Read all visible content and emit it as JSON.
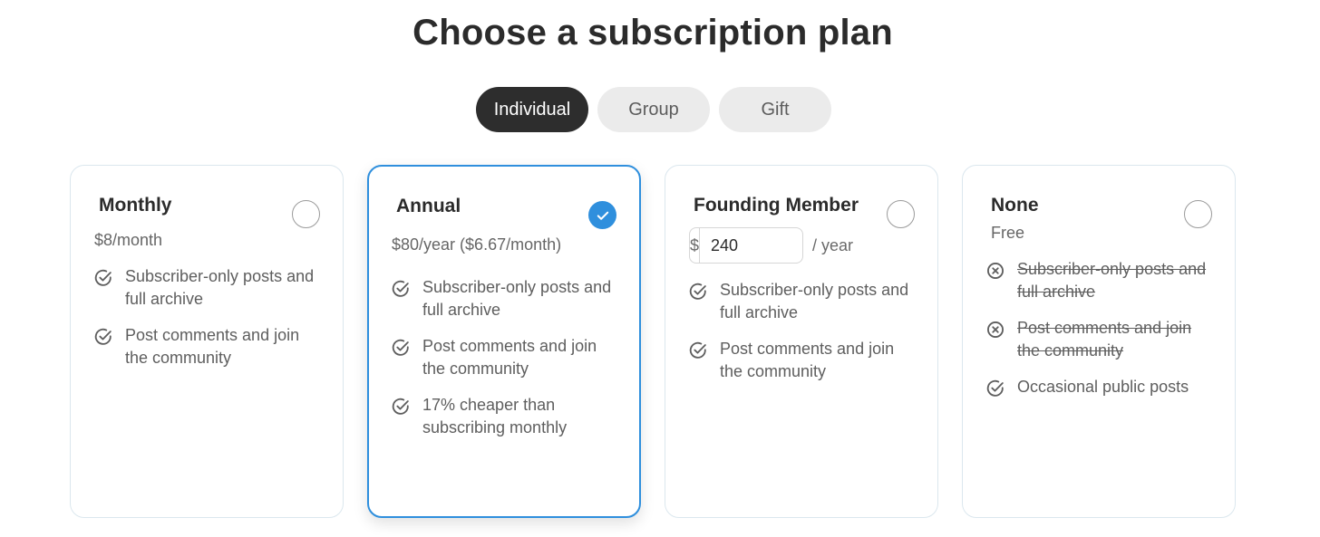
{
  "page": {
    "title": "Choose a subscription plan"
  },
  "tabs": [
    {
      "label": "Individual",
      "active": true
    },
    {
      "label": "Group",
      "active": false
    },
    {
      "label": "Gift",
      "active": false
    }
  ],
  "plans": [
    {
      "name": "Monthly",
      "price": "$8/month",
      "selected": false,
      "features": [
        {
          "text": "Subscriber-only posts and full archive",
          "included": true
        },
        {
          "text": "Post comments and join the community",
          "included": true
        }
      ]
    },
    {
      "name": "Annual",
      "price": "$80/year ($6.67/month)",
      "selected": true,
      "features": [
        {
          "text": "Subscriber-only posts and full archive",
          "included": true
        },
        {
          "text": "Post comments and join the community",
          "included": true
        },
        {
          "text": "17% cheaper than subscribing monthly",
          "included": true
        }
      ]
    },
    {
      "name": "Founding Member",
      "currency_symbol": "$",
      "amount_value": "240",
      "period": "/ year",
      "selected": false,
      "features": [
        {
          "text": "Subscriber-only posts and full archive",
          "included": true
        },
        {
          "text": "Post comments and join the community",
          "included": true
        }
      ]
    },
    {
      "name": "None",
      "price": "Free",
      "selected": false,
      "features": [
        {
          "text": "Subscriber-only posts and full archive",
          "included": false
        },
        {
          "text": "Post comments and join the community",
          "included": false
        },
        {
          "text": "Occasional public posts",
          "included": true
        }
      ]
    }
  ],
  "icons": {
    "included": "check-circle-icon",
    "excluded": "x-circle-icon",
    "selected": "checkmark-icon"
  },
  "colors": {
    "accent": "#2f8fdd",
    "active_tab": "#2d2d2d",
    "inactive_tab": "#ebebeb",
    "card_border": "#dbe7ee"
  }
}
